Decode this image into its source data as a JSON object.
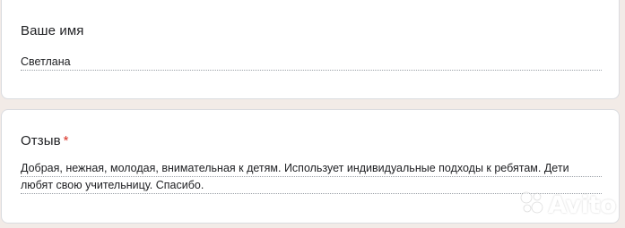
{
  "form": {
    "name_question": {
      "label": "Ваше имя",
      "answer": "Светлана"
    },
    "review_question": {
      "label": "Отзыв",
      "required_mark": "*",
      "answer_line1": "Добрая, нежная, молодая, внимательная к детям. Использует индивидуальные подходы к ребятам. Дети",
      "answer_line2": "любят свою учительницу. Спасибо."
    }
  },
  "watermark": {
    "text": "Avito",
    "icon": "avito-dots-icon"
  },
  "colors": {
    "page_background": "#f2ebe7",
    "card_background": "#ffffff",
    "required": "#d93025"
  }
}
